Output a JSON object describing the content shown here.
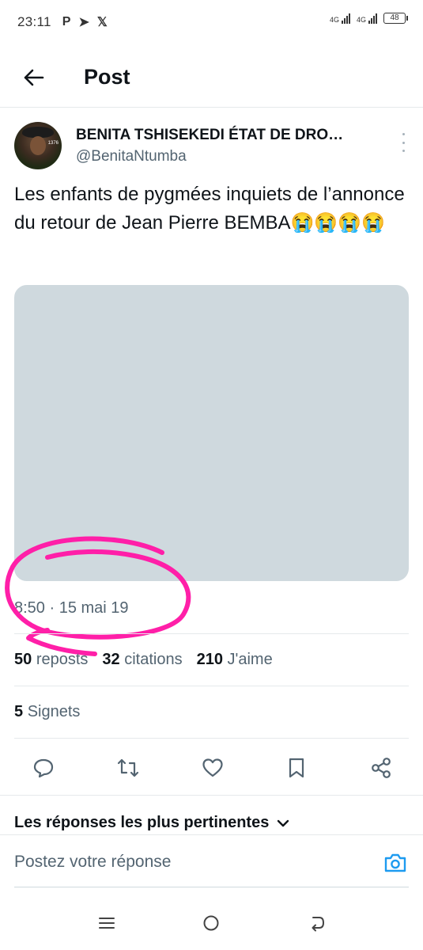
{
  "status_bar": {
    "time": "23:11",
    "left_icons": [
      "P",
      "➤",
      "𝕏"
    ],
    "network": [
      "4G",
      "4G"
    ],
    "battery": "48"
  },
  "header": {
    "title": "Post",
    "back_icon": "arrow-left-icon"
  },
  "author": {
    "name": "BENITA TSHISEKEDI ÉTAT DE DRO…",
    "handle": "@BenitaNtumba",
    "avatar_badge": "1376"
  },
  "post": {
    "text": "Les enfants de pygmées inquiets de l’annonce du retour de Jean Pierre BEMBA😭😭😭😭",
    "timestamp": "8:50 · 15 mai 19"
  },
  "stats": {
    "reposts_count": "50",
    "reposts_label": "reposts",
    "quotes_count": "32",
    "quotes_label": "citations",
    "likes_count": "210",
    "likes_label": "J'aime",
    "bookmarks_count": "5",
    "bookmarks_label": "Signets"
  },
  "actions": [
    "reply-icon",
    "repost-icon",
    "like-icon",
    "bookmark-icon",
    "share-icon"
  ],
  "replies": {
    "sort_label": "Les réponses les plus pertinentes",
    "input_placeholder": "Postez votre réponse"
  },
  "colors": {
    "text": "#0f1419",
    "secondary": "#536471",
    "divider": "#e6e9eb",
    "media_placeholder": "#cfd9de",
    "accent": "#1d9bf0",
    "annotation": "#ff1fa8"
  }
}
